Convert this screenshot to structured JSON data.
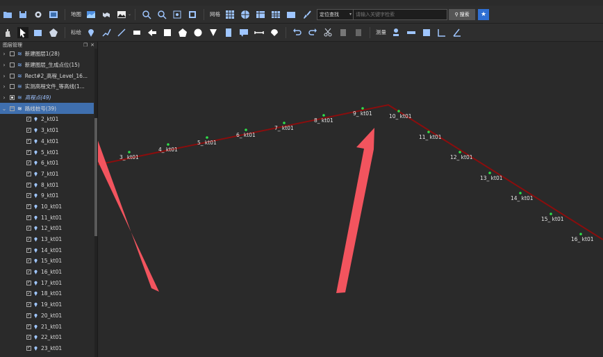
{
  "toolbar1": {
    "map_label": "地图",
    "grid_label": "网格",
    "search_type": "定位查找",
    "search_placeholder": "请输入关键字检索",
    "search_button": "搜索"
  },
  "toolbar2": {
    "annotate_label": "标绘",
    "measure_label": "测量"
  },
  "panel": {
    "title": "图层管理",
    "layers": [
      {
        "label": "新建图层1(28)",
        "checked": false
      },
      {
        "label": "新建图层_生成点位(15)",
        "checked": false
      },
      {
        "label": "Rect#2_高程_Level_16...",
        "checked": false
      },
      {
        "label": "实测高程文件_等高线(1...",
        "checked": false
      },
      {
        "label": "高程点(49)",
        "checked": true
      }
    ],
    "selected_layer": "路线桩号(39)",
    "children": [
      "2_kt01",
      "3_kt01",
      "4_kt01",
      "5_kt01",
      "6_kt01",
      "7_kt01",
      "8_kt01",
      "9_kt01",
      "10_kt01",
      "11_kt01",
      "12_kt01",
      "13_kt01",
      "14_kt01",
      "15_kt01",
      "16_kt01",
      "17_kt01",
      "18_kt01",
      "19_kt01",
      "20_kt01",
      "21_kt01",
      "22_kt01",
      "23_kt01"
    ]
  },
  "map": {
    "line_color": "#8b0d0d",
    "point_color": "#2fe04a",
    "arrow_color": "#f2545e",
    "labels": [
      "3_ kt01",
      "4_ kt01",
      "5_ kt01",
      "6_ kt01",
      "7_ kt01",
      "8_ kt01",
      "9_ kt01",
      "10_ kt01",
      "11_ kt01",
      "12_ kt01",
      "13_ kt01",
      "14_ kt01",
      "15_ kt01",
      "16_ kt01"
    ]
  }
}
